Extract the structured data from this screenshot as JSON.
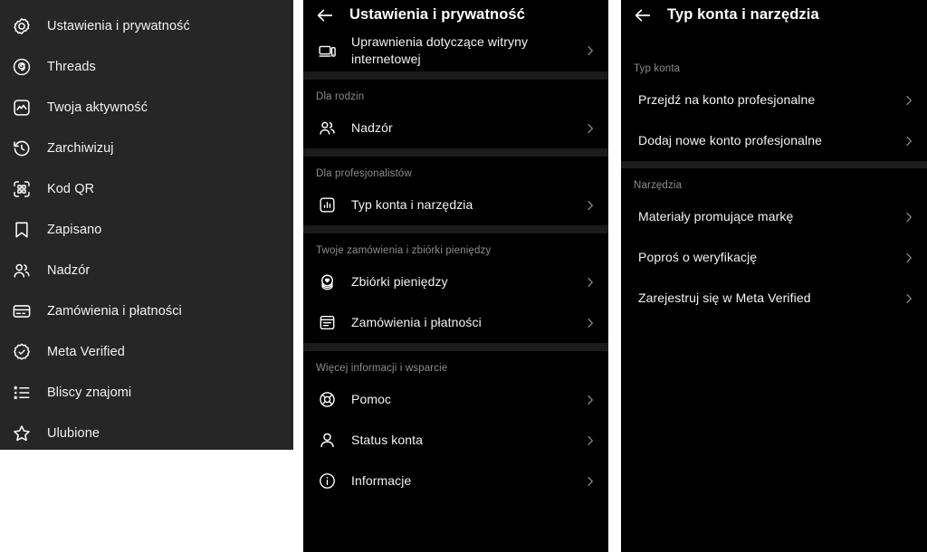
{
  "drawer": {
    "name": "instagram-settings-drawer",
    "background": "#262626",
    "items": [
      {
        "label": "Ustawienia i prywatność",
        "icon": "gear-icon"
      },
      {
        "label": "Threads",
        "icon": "threads-icon"
      },
      {
        "label": "Twoja aktywność",
        "icon": "activity-chart-icon"
      },
      {
        "label": "Zarchiwizuj",
        "icon": "archive-clock-icon"
      },
      {
        "label": "Kod QR",
        "icon": "qr-code-icon"
      },
      {
        "label": "Zapisano",
        "icon": "bookmark-icon"
      },
      {
        "label": "Nadzór",
        "icon": "supervision-people-icon"
      },
      {
        "label": "Zamówienia i płatności",
        "icon": "credit-card-icon"
      },
      {
        "label": "Meta Verified",
        "icon": "verified-badge-icon"
      },
      {
        "label": "Bliscy znajomi",
        "icon": "close-friends-list-icon"
      },
      {
        "label": "Ulubione",
        "icon": "star-icon"
      }
    ]
  },
  "settings_panel": {
    "title": "Ustawienia i prywatność",
    "back_icon": "back-arrow-icon",
    "top_rows": [
      {
        "label": "Uprawnienia dotyczące witryny internetowej",
        "icon": "website-permissions-icon",
        "chevron": "chevron-right-icon"
      }
    ],
    "sections": [
      {
        "title": "Dla rodzin",
        "rows": [
          {
            "label": "Nadzór",
            "icon": "supervision-people-icon",
            "chevron": "chevron-right-icon"
          }
        ]
      },
      {
        "title": "Dla profesjonalistów",
        "rows": [
          {
            "label": "Typ konta i narzędzia",
            "icon": "account-tools-chart-icon",
            "chevron": "chevron-right-icon"
          }
        ]
      },
      {
        "title": "Twoje zamówienia i zbiórki pieniędzy",
        "rows": [
          {
            "label": "Zbiórki pieniędzy",
            "icon": "fundraiser-heart-icon",
            "chevron": "chevron-right-icon"
          },
          {
            "label": "Zamówienia i płatności",
            "icon": "orders-box-icon",
            "chevron": "chevron-right-icon"
          }
        ]
      },
      {
        "title": "Więcej informacji i wsparcie",
        "rows": [
          {
            "label": "Pomoc",
            "icon": "help-lifering-icon",
            "chevron": "chevron-right-icon"
          },
          {
            "label": "Status konta",
            "icon": "person-icon",
            "chevron": "chevron-right-icon"
          },
          {
            "label": "Informacje",
            "icon": "info-icon",
            "chevron": "chevron-right-icon"
          }
        ]
      }
    ]
  },
  "account_panel": {
    "title": "Typ konta i narzędzia",
    "back_icon": "back-arrow-icon",
    "sections": [
      {
        "title": "Typ konta",
        "rows": [
          {
            "label": "Przejdź na konto profesjonalne",
            "chevron": "chevron-right-icon"
          },
          {
            "label": "Dodaj nowe konto profesjonalne",
            "chevron": "chevron-right-icon"
          }
        ]
      },
      {
        "title": "Narzędzia",
        "rows": [
          {
            "label": "Materiały promujące markę",
            "chevron": "chevron-right-icon"
          },
          {
            "label": "Poproś o weryfikację",
            "chevron": "chevron-right-icon"
          },
          {
            "label": "Zarejestruj się w Meta Verified",
            "chevron": "chevron-right-icon"
          }
        ]
      }
    ]
  },
  "colors": {
    "drawer_bg": "#262626",
    "panel_bg": "#000000",
    "separator": "#1b1b1b",
    "primary_text": "#f3f3f3",
    "muted_text": "#8d8d8d",
    "chevron": "#9a9a9a"
  }
}
